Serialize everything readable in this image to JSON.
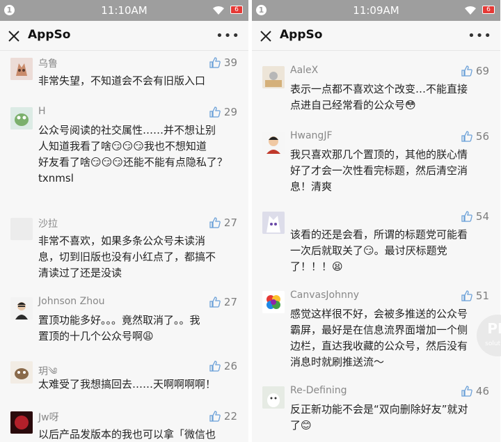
{
  "left": {
    "status": {
      "badge": "1",
      "time": "11:10AM",
      "battery": "6"
    },
    "nav": {
      "title": "AppSo",
      "more": "•••"
    },
    "comments": [
      {
        "name": "乌鲁",
        "likes": "39",
        "lines": [
          "非常失望，不知道会不会有旧版入口"
        ]
      },
      {
        "name": "H",
        "likes": "29",
        "lines": [
          "公众号阅读的社交属性……并不想让别",
          "人知道我看了啥😏😏😏我也不想知道",
          "好友看了啥😏😏😏还能不能有点隐私了？",
          "txnmsl"
        ]
      },
      {
        "name": "沙拉",
        "likes": "27",
        "lines": [
          "非常不喜欢，如果多条公众号未读消",
          "息，切到旧版也没有小红点了，都搞不",
          "清读过了还是没读"
        ]
      },
      {
        "name": "Johnson Zhou",
        "likes": "27",
        "lines": [
          "置顶功能多好。。。竟然取消了。。我",
          "置顶的十几个公众号啊😩"
        ]
      },
      {
        "name": "玥༄",
        "likes": "26",
        "lines": [
          "太难受了我想搞回去……天啊啊啊啊！"
        ]
      },
      {
        "name": "Jw呀",
        "likes": "22",
        "lines": [
          "以后产品发版本的我也可以拿「微信也"
        ]
      }
    ]
  },
  "right": {
    "status": {
      "badge": "1",
      "time": "11:09AM",
      "battery": "6"
    },
    "nav": {
      "title": "AppSo",
      "more": "•••"
    },
    "comments": [
      {
        "name": "AaleX",
        "likes": "69",
        "lines": [
          "表示一点都不喜欢这个改变…不能直接",
          "点进自己经常看的公众号😳"
        ]
      },
      {
        "name": "HwangJF",
        "likes": "56",
        "lines": [
          "我只喜欢那几个置顶的，其他的朕心情",
          "好了才会一次性看完标题，然后清空消",
          "息！清爽"
        ]
      },
      {
        "name": "",
        "likes": "54",
        "lines": [
          "该看的还是会看，所谓的标题党可能看",
          "一次后就取关了😏。最讨厌标题党",
          "了！！！😫"
        ]
      },
      {
        "name": "CanvasJohnny",
        "likes": "51",
        "lines": [
          "感觉这样很不好，会被多推送的公众号",
          "霸屏，最好是在信息流界面增加一个侧",
          "边栏，直达我收藏的公众号，然后没有",
          "消息时就刷推送流～"
        ]
      },
      {
        "name": "Re-Defining",
        "likes": "46",
        "lines": [
          "反正新功能不会是“双向删除好友”就对",
          "了😊"
        ]
      }
    ]
  },
  "watermark": {
    "text": "PP",
    "sub": "solution"
  },
  "colors": {
    "statusbar": "#9e9e9e",
    "battery": "#e53935",
    "page": "#f7f7f7"
  }
}
